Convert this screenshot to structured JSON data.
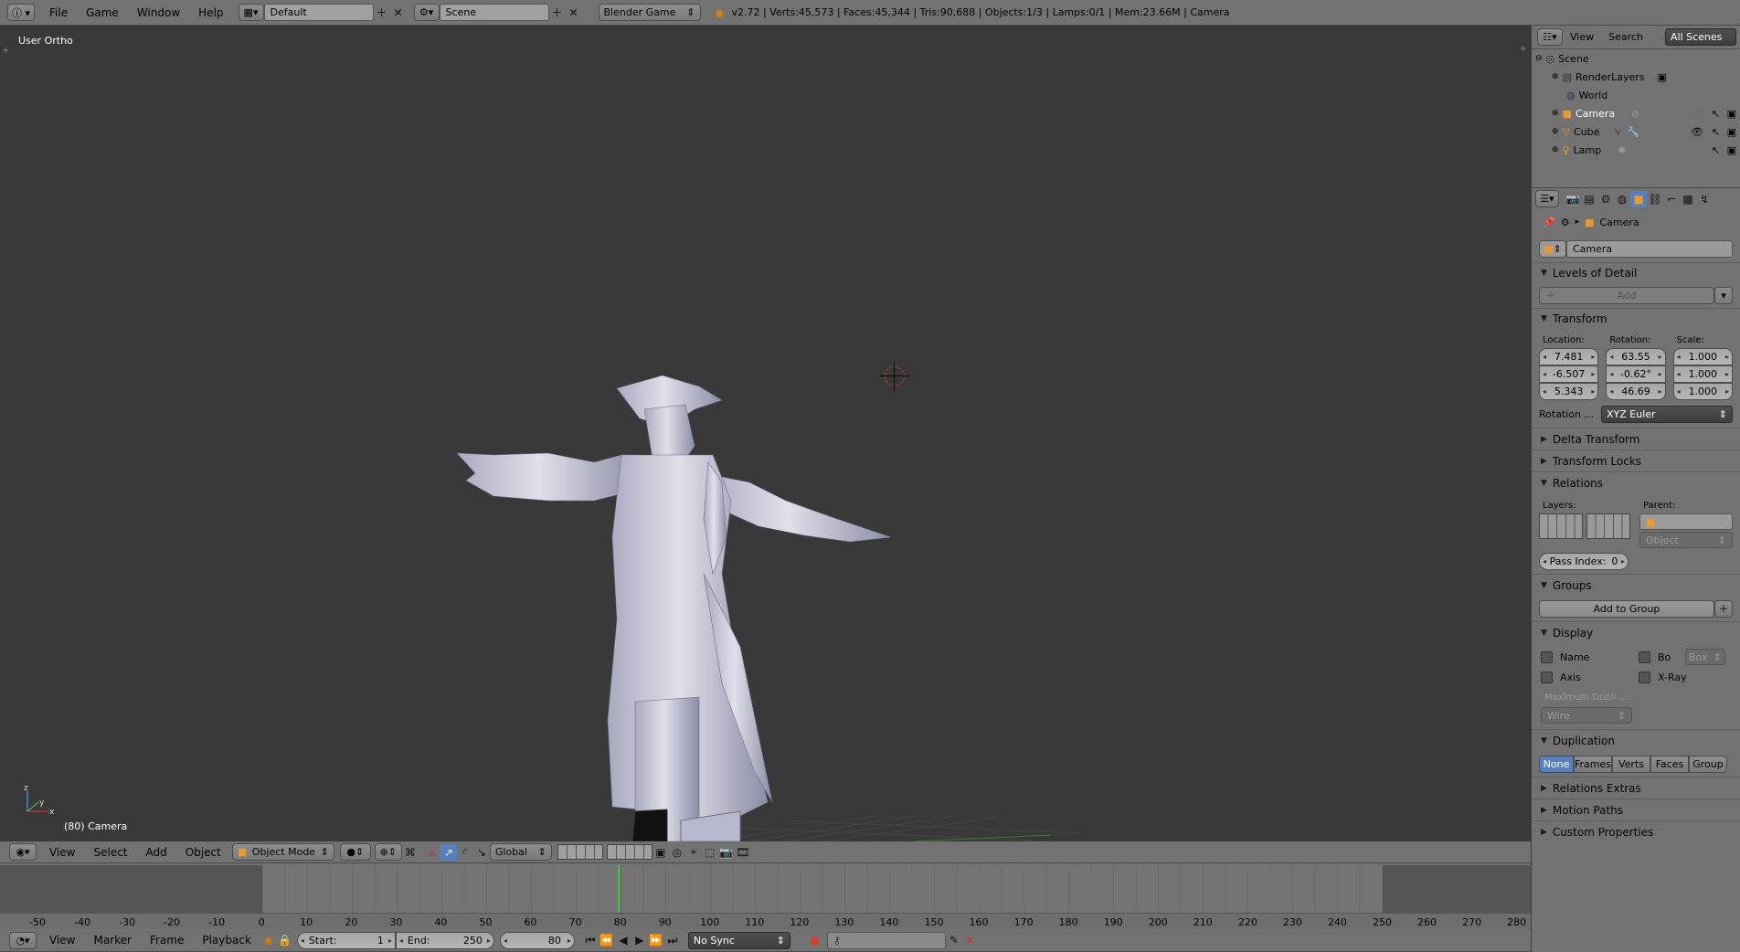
{
  "topbar": {
    "menus": [
      "File",
      "Game",
      "Window",
      "Help"
    ],
    "screen_layout": "Default",
    "scene": "Scene",
    "engine": "Blender Game",
    "stats": "v2.72 | Verts:45,573 | Faces:45,344 | Tris:90,688 | Objects:1/3 | Lamps:0/1 | Mem:23.66M | Camera"
  },
  "viewport": {
    "view_name": "User Ortho",
    "object_label": "(80) Camera",
    "axes": {
      "x": "x",
      "y": "y",
      "z": "z"
    }
  },
  "view3d_header": {
    "menus": [
      "View",
      "Select",
      "Add",
      "Object"
    ],
    "mode": "Object Mode",
    "orientation": "Global"
  },
  "timeline": {
    "ticks": [
      "-50",
      "-40",
      "-30",
      "-20",
      "-10",
      "0",
      "10",
      "20",
      "30",
      "40",
      "50",
      "60",
      "70",
      "80",
      "90",
      "100",
      "110",
      "120",
      "130",
      "140",
      "150",
      "160",
      "170",
      "180",
      "190",
      "200",
      "210",
      "220",
      "230",
      "240",
      "250",
      "260",
      "270",
      "280"
    ],
    "current_frame": 80
  },
  "timeline_header": {
    "menus": [
      "View",
      "Marker",
      "Frame",
      "Playback"
    ],
    "start_label": "Start:",
    "start": "1",
    "end_label": "End:",
    "end": "250",
    "frame": "80",
    "sync": "No Sync"
  },
  "outliner": {
    "menus": [
      "View",
      "Search"
    ],
    "filter": "All Scenes",
    "items": [
      {
        "label": "Scene",
        "icon": "scene-icon"
      },
      {
        "label": "RenderLayers",
        "icon": "renderlayers-icon"
      },
      {
        "label": "World",
        "icon": "world-icon"
      },
      {
        "label": "Camera",
        "icon": "camera-icon"
      },
      {
        "label": "Cube",
        "icon": "mesh-icon"
      },
      {
        "label": "Lamp",
        "icon": "lamp-icon"
      }
    ]
  },
  "properties": {
    "breadcrumb": "Camera",
    "object_name": "Camera",
    "lod": {
      "title": "Levels of Detail",
      "add": "Add"
    },
    "transform": {
      "title": "Transform",
      "location_label": "Location:",
      "rotation_label": "Rotation:",
      "scale_label": "Scale:",
      "location": [
        "7.481",
        "-6.507",
        "5.343"
      ],
      "rotation": [
        "63.55",
        "-0.62°",
        "46.69"
      ],
      "scale": [
        "1.000",
        "1.000",
        "1.000"
      ],
      "rotation_mode_label": "Rotation ...",
      "rotation_mode": "XYZ Euler"
    },
    "delta_transform": "Delta Transform",
    "transform_locks": "Transform Locks",
    "relations": {
      "title": "Relations",
      "layers": "Layers:",
      "parent": "Parent:",
      "parent_type": "Object",
      "pass_index": "Pass Index:",
      "pass_value": "0"
    },
    "groups": {
      "title": "Groups",
      "add": "Add to Group"
    },
    "display": {
      "title": "Display",
      "name": "Name",
      "bounds": "Bo",
      "bounds_type": "Box",
      "axis": "Axis",
      "xray": "X-Ray",
      "max_dupli": "Maximum Dupli ...",
      "max_type": "Wire"
    },
    "duplication": {
      "title": "Duplication",
      "options": [
        "None",
        "Frames",
        "Verts",
        "Faces",
        "Group"
      ]
    },
    "relations_extras": "Relations Extras",
    "motion_paths": "Motion Paths",
    "custom_properties": "Custom Properties"
  },
  "colors": {
    "accent": "#5680c2",
    "frame_line": "#3cc93c",
    "viewport_bg": "#393939"
  }
}
